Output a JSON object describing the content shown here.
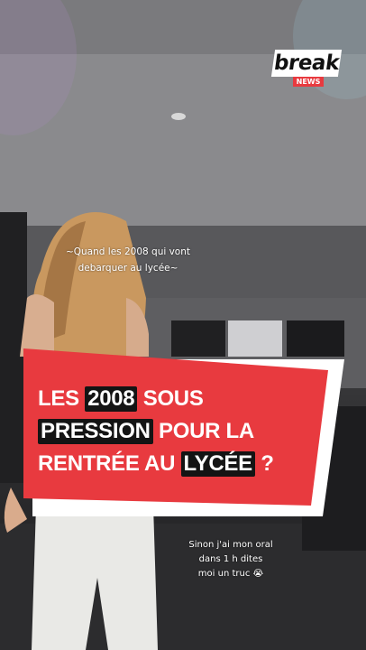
{
  "brand": {
    "logo_text": "break",
    "logo_sub": "NEWS",
    "accent_color": "#e83a3f"
  },
  "captions": {
    "top_line1": "~Quand les 2008 qui vont",
    "top_line2": "debarquer au lycée~",
    "bottom_line1": "Sinon j'ai mon oral dans 1 h dites",
    "bottom_line2": "moi un truc 😭"
  },
  "headline": {
    "line1": {
      "a": "LES",
      "b": "2008",
      "c": "SOUS"
    },
    "line2": {
      "a": "PRESSION",
      "b": "POUR LA"
    },
    "line3": {
      "a": "RENTRÉE AU",
      "b": "LYCÉE",
      "c": "?"
    }
  },
  "colors": {
    "banner_red": "#e83a3f",
    "banner_white": "#ffffff",
    "highlight_dark": "#141414"
  }
}
